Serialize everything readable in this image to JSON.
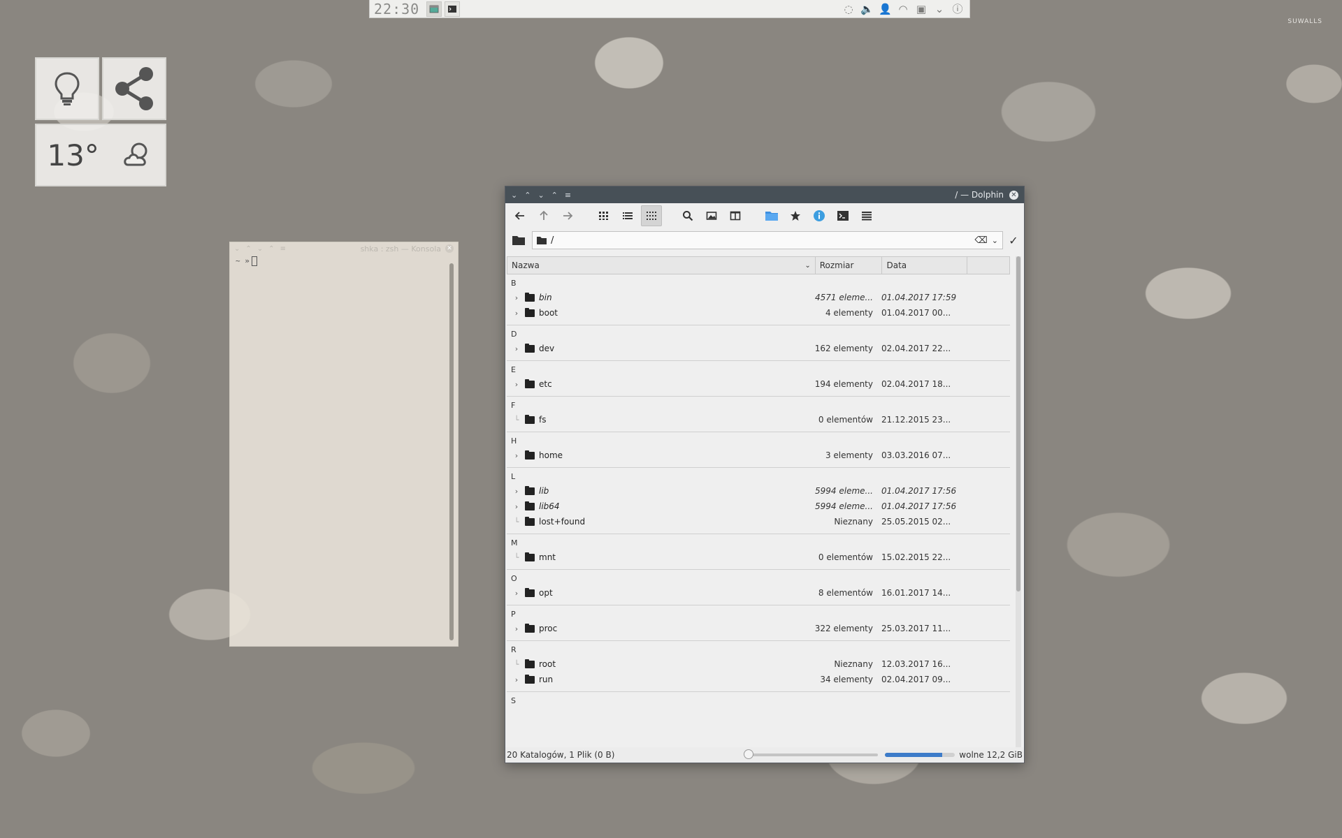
{
  "wallpaper_mark": "SUWALLS",
  "top_panel": {
    "clock": "22:30",
    "tray_icons": [
      "network-activity-icon",
      "volume-icon",
      "user-icon",
      "wifi-icon",
      "clipboard-icon",
      "chevron-down-icon",
      "notification-icon"
    ]
  },
  "widgets": {
    "weather_temp": "13°"
  },
  "konsole": {
    "title": "shka : zsh — Konsola",
    "prompt": "~ »"
  },
  "dolphin": {
    "title": "/ — Dolphin",
    "location": "/",
    "columns": {
      "name": "Nazwa",
      "size": "Rozmiar",
      "date": "Data"
    },
    "groups": [
      {
        "letter": "B",
        "items": [
          {
            "name": "bin",
            "size": "4571 eleme...",
            "date": "01.04.2017 17:59",
            "link": true,
            "expandable": true
          },
          {
            "name": "boot",
            "size": "4 elementy",
            "date": "01.04.2017 00...",
            "link": false,
            "expandable": true
          }
        ]
      },
      {
        "letter": "D",
        "items": [
          {
            "name": "dev",
            "size": "162 elementy",
            "date": "02.04.2017 22...",
            "link": false,
            "expandable": true
          }
        ]
      },
      {
        "letter": "E",
        "items": [
          {
            "name": "etc",
            "size": "194 elementy",
            "date": "02.04.2017 18...",
            "link": false,
            "expandable": true
          }
        ]
      },
      {
        "letter": "F",
        "items": [
          {
            "name": "fs",
            "size": "0 elementów",
            "date": "21.12.2015 23...",
            "link": false,
            "expandable": false
          }
        ]
      },
      {
        "letter": "H",
        "items": [
          {
            "name": "home",
            "size": "3 elementy",
            "date": "03.03.2016 07...",
            "link": false,
            "expandable": true
          }
        ]
      },
      {
        "letter": "L",
        "items": [
          {
            "name": "lib",
            "size": "5994 eleme...",
            "date": "01.04.2017 17:56",
            "link": true,
            "expandable": true
          },
          {
            "name": "lib64",
            "size": "5994 eleme...",
            "date": "01.04.2017 17:56",
            "link": true,
            "expandable": true
          },
          {
            "name": "lost+found",
            "size": "Nieznany",
            "date": "25.05.2015 02...",
            "link": false,
            "expandable": false
          }
        ]
      },
      {
        "letter": "M",
        "items": [
          {
            "name": "mnt",
            "size": "0 elementów",
            "date": "15.02.2015 22...",
            "link": false,
            "expandable": false
          }
        ]
      },
      {
        "letter": "O",
        "items": [
          {
            "name": "opt",
            "size": "8 elementów",
            "date": "16.01.2017 14...",
            "link": false,
            "expandable": true
          }
        ]
      },
      {
        "letter": "P",
        "items": [
          {
            "name": "proc",
            "size": "322 elementy",
            "date": "25.03.2017 11...",
            "link": false,
            "expandable": true
          }
        ]
      },
      {
        "letter": "R",
        "items": [
          {
            "name": "root",
            "size": "Nieznany",
            "date": "12.03.2017 16...",
            "link": false,
            "expandable": false
          },
          {
            "name": "run",
            "size": "34 elementy",
            "date": "02.04.2017 09...",
            "link": false,
            "expandable": true
          }
        ]
      },
      {
        "letter": "S",
        "items": []
      }
    ],
    "status": {
      "summary": "20 Katalogów, 1 Plik (0 B)",
      "free_space": "wolne 12,2 GiB",
      "zoom_fraction": 0.0,
      "used_fraction": 0.82
    }
  },
  "colors": {
    "titlebar": "#475057",
    "accent": "#3d7cc9"
  }
}
